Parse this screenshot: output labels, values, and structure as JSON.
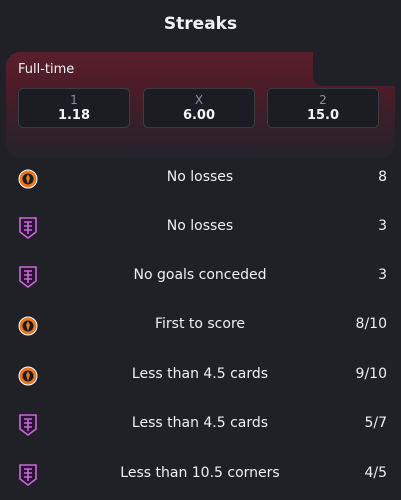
{
  "header": {
    "title": "Streaks"
  },
  "full_time": {
    "label": "Full-time",
    "odds": [
      {
        "key": "1",
        "value": "1.18"
      },
      {
        "key": "X",
        "value": "6.00"
      },
      {
        "key": "2",
        "value": "15.0"
      }
    ]
  },
  "colors": {
    "accent_maroon": "#5a1f2c",
    "team_home": "#e87722",
    "team_away": "#c76ad8"
  },
  "streaks": [
    {
      "team_icon": "shakhtar-crest-icon",
      "label": "No losses",
      "value": "8"
    },
    {
      "team_icon": "opponent-crest-icon",
      "label": "No losses",
      "value": "3"
    },
    {
      "team_icon": "opponent-crest-icon",
      "label": "No goals conceded",
      "value": "3"
    },
    {
      "team_icon": "shakhtar-crest-icon",
      "label": "First to score",
      "value": "8/10"
    },
    {
      "team_icon": "shakhtar-crest-icon",
      "label": "Less than 4.5 cards",
      "value": "9/10"
    },
    {
      "team_icon": "opponent-crest-icon",
      "label": "Less than 4.5 cards",
      "value": "5/7"
    },
    {
      "team_icon": "opponent-crest-icon",
      "label": "Less than 10.5 corners",
      "value": "4/5"
    }
  ]
}
